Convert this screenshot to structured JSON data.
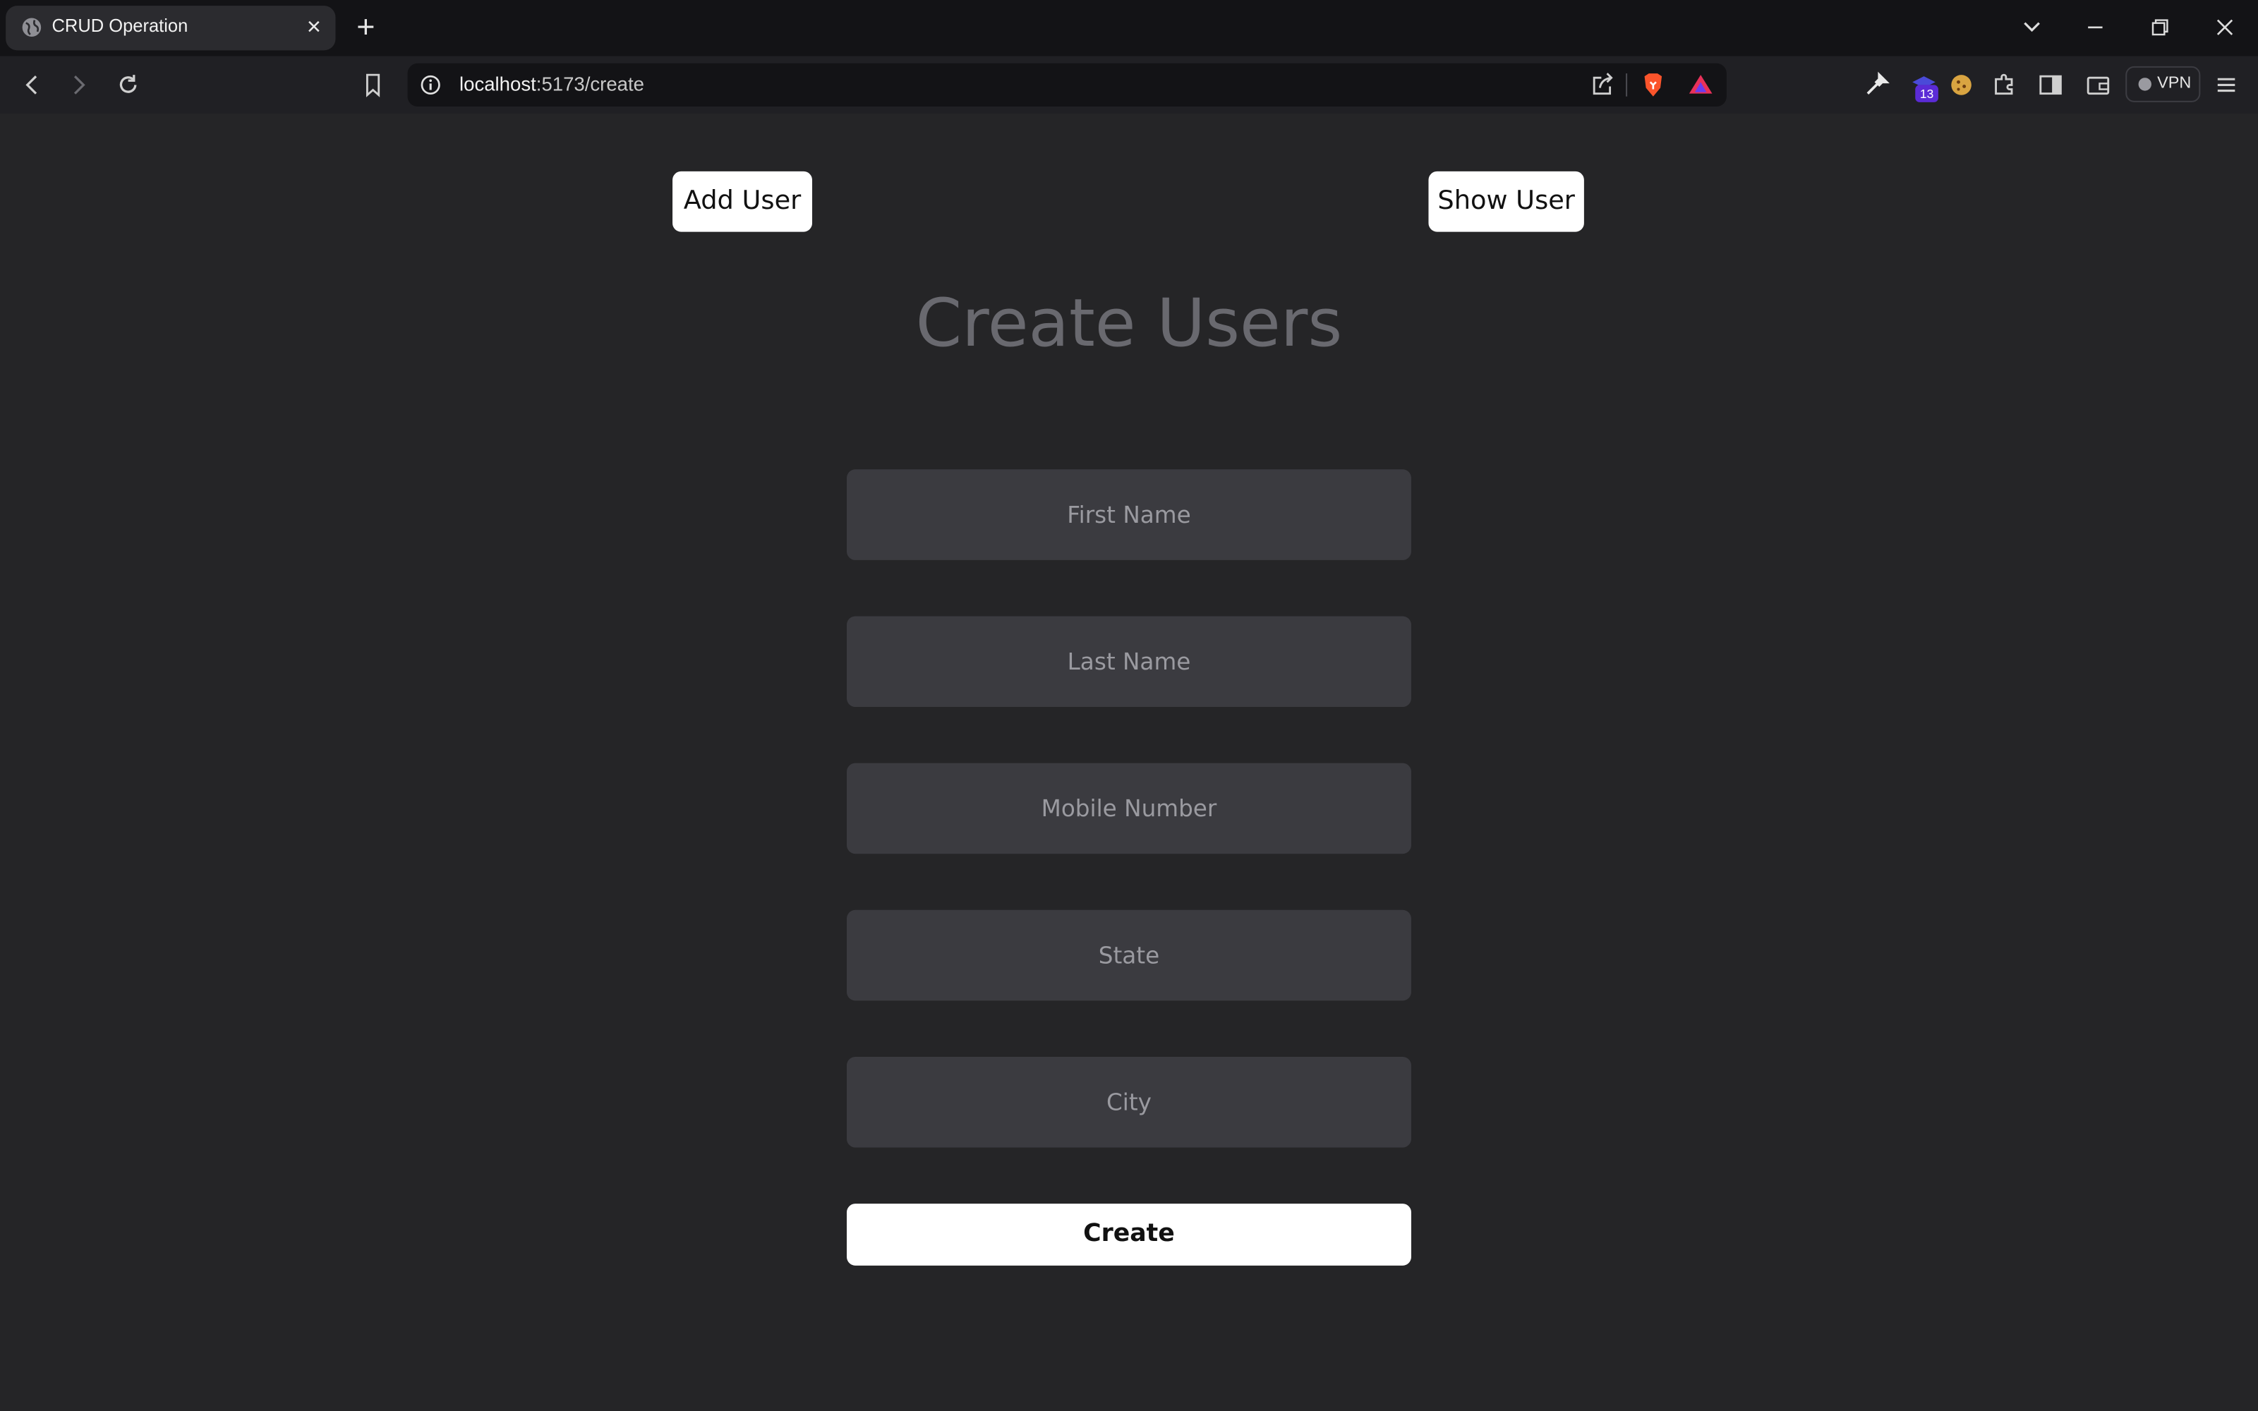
{
  "browser": {
    "tab": {
      "title": "CRUD Operation",
      "favicon": "globe-icon"
    },
    "address": {
      "host": "localhost",
      "path": ":5173/create"
    },
    "extension_badge_count": "13",
    "vpn_label": "VPN"
  },
  "page": {
    "add_user_label": "Add User",
    "show_user_label": "Show User",
    "title": "Create Users",
    "fields": {
      "first_name_placeholder": "First Name",
      "last_name_placeholder": "Last Name",
      "mobile_placeholder": "Mobile Number",
      "state_placeholder": "State",
      "city_placeholder": "City"
    },
    "create_label": "Create"
  },
  "colors": {
    "background": "#252527",
    "field_bg": "#3b3b40",
    "heading": "#69696f",
    "button_bg": "#ffffff",
    "brave_orange": "#fb542b"
  }
}
